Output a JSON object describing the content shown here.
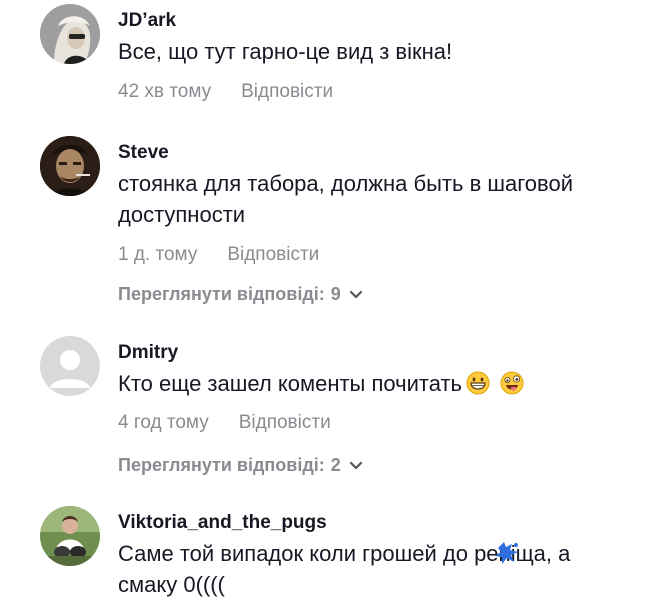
{
  "comments": [
    {
      "username": "JD’ark",
      "text": "Все, що тут гарно-це вид з вікна!",
      "time": "42 хв тому",
      "reply_label": "Відповісти"
    },
    {
      "username": "Steve",
      "text": "стоянка для табора, должна быть в шаговой доступности",
      "time": "1 д. тому",
      "reply_label": "Відповісти",
      "view_replies_label": "Переглянути відповіді:",
      "replies_count": "9"
    },
    {
      "username": "Dmitry",
      "text": "Кто еще зашел коменты почитать",
      "time": "4 год тому",
      "reply_label": "Відповісти",
      "view_replies_label": "Переглянути відповіді:",
      "replies_count": "2",
      "emojis": [
        "grinning-face-emoji",
        "zany-face-emoji"
      ]
    },
    {
      "username": "Viktoria_and_the_pugs",
      "text": "Саме той випадок коли грошей до реніща, а смаку 0((((",
      "overlay_icon": "blue-splash-icon"
    }
  ],
  "icons": {
    "chevron": "chevron-down-icon",
    "default_avatar": "default-avatar-icon"
  },
  "colors": {
    "text_primary": "#161823",
    "text_secondary": "#8a8b91",
    "overlay_blue": "#2f6fe0"
  }
}
